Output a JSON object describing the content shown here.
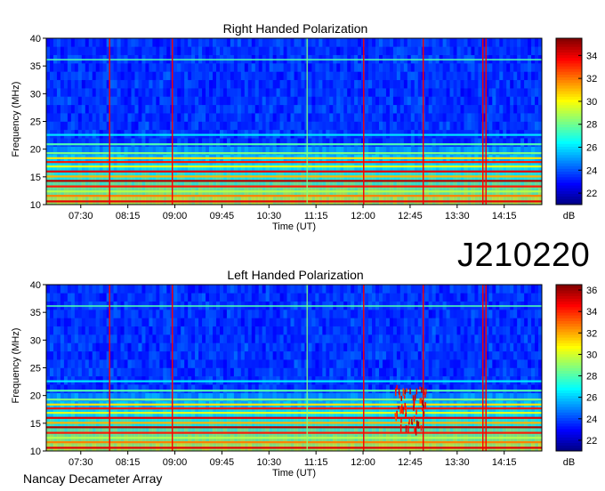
{
  "observation_id": "J210220",
  "footer": "Nancay Decameter Array",
  "colors": {
    "low": "#00007f",
    "mid": "#00ff80",
    "high": "#7f0000"
  },
  "chart_data": [
    {
      "type": "heatmap",
      "title": "Right Handed Polarization",
      "xlabel": "Time (UT)",
      "ylabel": "Frequency (MHz)",
      "x_ticks": [
        "07:30",
        "08:15",
        "09:00",
        "09:45",
        "10:30",
        "11:15",
        "12:00",
        "12:45",
        "13:30",
        "14:15"
      ],
      "x_tick_hours": [
        7.5,
        8.25,
        9.0,
        9.75,
        10.5,
        11.25,
        12.0,
        12.75,
        13.5,
        14.25
      ],
      "xlim_hours": [
        6.95,
        14.85
      ],
      "y_ticks": [
        10,
        15,
        20,
        25,
        30,
        35,
        40
      ],
      "ylim": [
        10,
        40
      ],
      "colorbar": {
        "label": "dB",
        "ticks": [
          22,
          24,
          26,
          28,
          30,
          32,
          34
        ],
        "range": [
          21,
          35.5
        ]
      }
    },
    {
      "type": "heatmap",
      "title": "Left Handed Polarization",
      "xlabel": "Time (UT)",
      "ylabel": "Frequency (MHz)",
      "x_ticks": [
        "07:30",
        "08:15",
        "09:00",
        "09:45",
        "10:30",
        "11:15",
        "12:00",
        "12:45",
        "13:30",
        "14:15"
      ],
      "x_tick_hours": [
        7.5,
        8.25,
        9.0,
        9.75,
        10.5,
        11.25,
        12.0,
        12.75,
        13.5,
        14.25
      ],
      "xlim_hours": [
        6.95,
        14.85
      ],
      "y_ticks": [
        10,
        15,
        20,
        25,
        30,
        35,
        40
      ],
      "ylim": [
        10,
        40
      ],
      "colorbar": {
        "label": "dB",
        "ticks": [
          22,
          24,
          26,
          28,
          30,
          32,
          34,
          36
        ],
        "range": [
          21,
          36.5
        ]
      }
    }
  ]
}
